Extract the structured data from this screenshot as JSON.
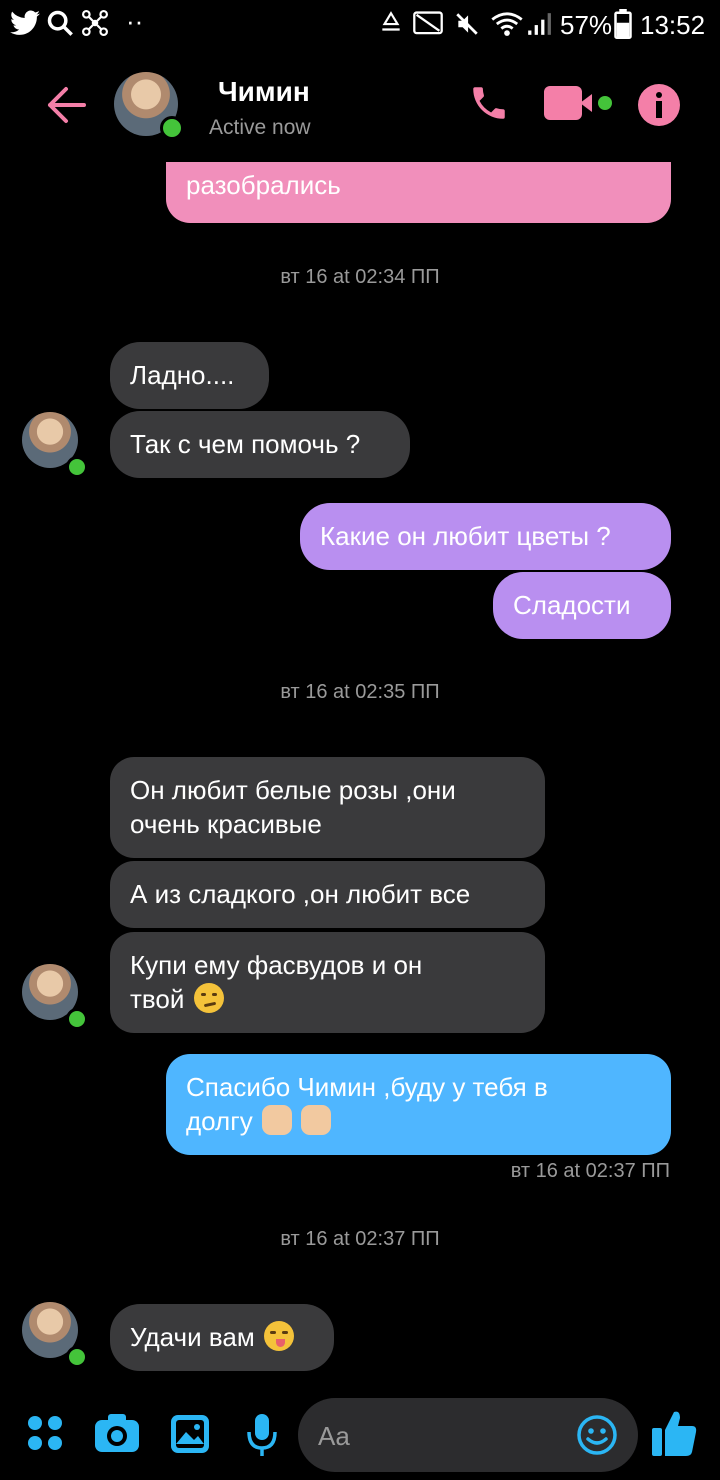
{
  "status_bar": {
    "battery": "57%",
    "time": "13:52"
  },
  "header": {
    "contact_name": "Чимин",
    "status": "Active now"
  },
  "messages": {
    "m0": "разобрались",
    "ts1": "вт 16 at 02:34 ПП",
    "m1": "Ладно....",
    "m2": "Так с чем помочь ?",
    "m3": "Какие он любит цветы ?",
    "m4": "Сладости",
    "ts2": "вт 16 at 02:35 ПП",
    "m5_line1": "Он любит белые розы ,они",
    "m5_line2": "очень красивые",
    "m6": "А из сладкого ,он любит все",
    "m7_line1": "Купи ему фасвудов и он",
    "m7_line2": "твой",
    "m8_line1": "Спасибо Чимин ,буду у тебя в",
    "m8_line2": "долгу",
    "m8_time": "вт 16 at 02:37 ПП",
    "ts3": "вт 16 at 02:37 ПП",
    "m9": "Удачи вам"
  },
  "composer": {
    "placeholder": "Aa"
  },
  "colors": {
    "accent_pink": "#f47fa8",
    "outgoing_pink": "#f18fbb",
    "outgoing_purple": "#b98ff0",
    "outgoing_blue": "#4fb6ff",
    "incoming": "#3a3a3c",
    "toolbar_blue": "#2bb6f4",
    "online": "#44c43a"
  },
  "icons": [
    "twitter-icon",
    "search-icon",
    "network-icon",
    "more-dots-icon",
    "recycle-icon",
    "cast-icon",
    "mute-icon",
    "wifi-icon",
    "signal-icon",
    "battery-icon",
    "back-arrow-icon",
    "phone-icon",
    "video-icon",
    "info-icon",
    "apps-icon",
    "camera-icon",
    "gallery-icon",
    "mic-icon",
    "emoji-icon",
    "like-icon"
  ]
}
